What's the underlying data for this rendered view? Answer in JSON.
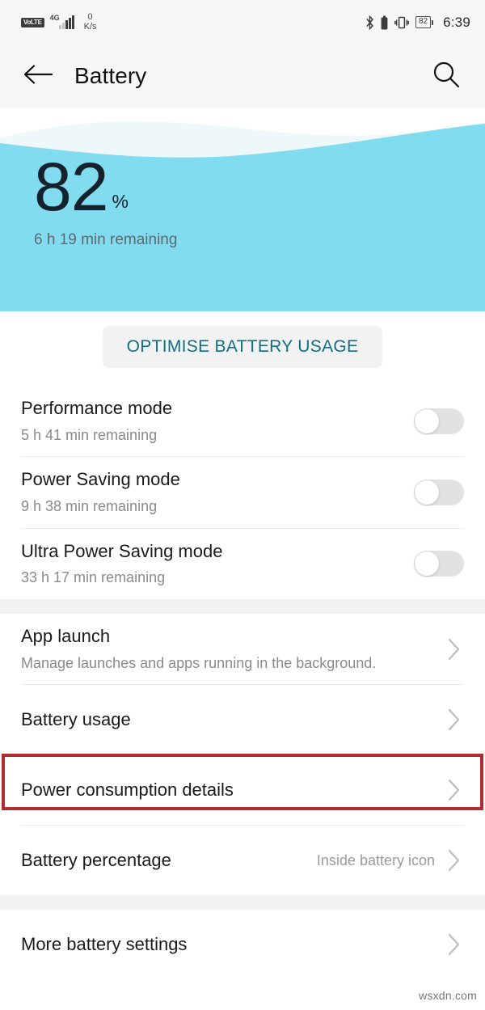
{
  "status_bar": {
    "volte_label": "VoLTE",
    "network_type": "4G",
    "net_speed_value": "0",
    "net_speed_unit": "K/s",
    "icons": [
      "bluetooth-icon",
      "battery-solid-icon",
      "vibrate-icon"
    ],
    "battery_percent": "82",
    "time": "6:39"
  },
  "app_bar": {
    "back_icon": "arrow-left-icon",
    "title": "Battery",
    "search_icon": "search-icon"
  },
  "hero": {
    "percent": "82",
    "percent_symbol": "%",
    "remaining": "6 h 19 min remaining",
    "wave_color": "#80dcee",
    "wave_back_color": "#eef8fb"
  },
  "optimise": {
    "label": "OPTIMISE BATTERY USAGE",
    "text_color": "#0e6f85",
    "bg_color": "#f2f2f2"
  },
  "modes": [
    {
      "title": "Performance mode",
      "subtitle": "5 h 41 min remaining",
      "toggle": "off"
    },
    {
      "title": "Power Saving mode",
      "subtitle": "9 h 38 min remaining",
      "toggle": "off"
    },
    {
      "title": "Ultra Power Saving mode",
      "subtitle": "33 h 17 min remaining",
      "toggle": "off"
    }
  ],
  "links": [
    {
      "title": "App launch",
      "subtitle": "Manage launches and apps running in the background.",
      "value": ""
    },
    {
      "title": "Battery usage",
      "subtitle": "",
      "value": ""
    },
    {
      "title": "Power consumption details",
      "subtitle": "",
      "value": ""
    },
    {
      "title": "Battery percentage",
      "subtitle": "",
      "value": "Inside battery icon"
    }
  ],
  "footer_links": [
    {
      "title": "More battery settings",
      "subtitle": "",
      "value": ""
    }
  ],
  "highlight": {
    "target": "Battery usage",
    "color": "#b22b30"
  },
  "watermark": "wsxdn.com"
}
